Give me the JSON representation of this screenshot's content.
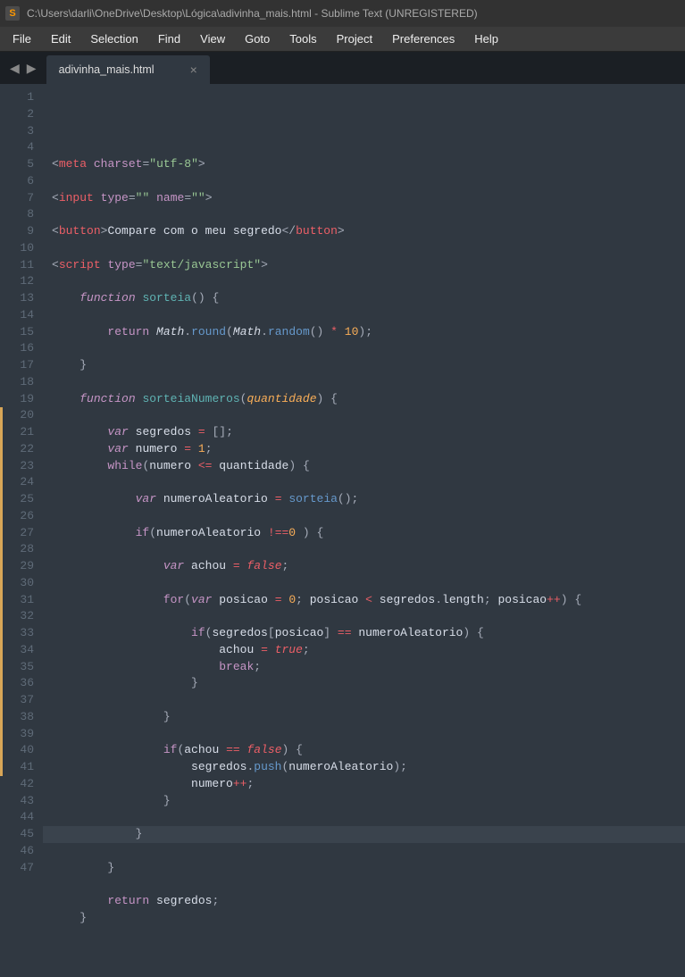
{
  "titlebar": {
    "path": "C:\\Users\\darli\\OneDrive\\Desktop\\Lógica\\adivinha_mais.html - Sublime Text (UNREGISTERED)",
    "icon_letter": "S"
  },
  "menu": {
    "file": "File",
    "edit": "Edit",
    "selection": "Selection",
    "find": "Find",
    "view": "View",
    "goto": "Goto",
    "tools": "Tools",
    "project": "Project",
    "preferences": "Preferences",
    "help": "Help"
  },
  "nav": {
    "back": "◀",
    "forward": "▶"
  },
  "tab": {
    "name": "adivinha_mais.html",
    "close": "×"
  },
  "gutter": {
    "first": 1,
    "last": 47,
    "modified_ranges": [
      [
        20,
        41
      ]
    ],
    "highlighted_line": 45
  },
  "code": {
    "lines": [
      {
        "n": 1,
        "html": "<span class='punct'>&lt;</span><span class='tag'>meta</span> <span class='attr'>charset</span><span class='punct'>=</span><span class='string'>\"utf-8\"</span><span class='punct'>&gt;</span>"
      },
      {
        "n": 2,
        "html": ""
      },
      {
        "n": 3,
        "html": "<span class='punct'>&lt;</span><span class='tag'>input</span> <span class='attr'>type</span><span class='punct'>=</span><span class='string'>\"\"</span> <span class='attr'>name</span><span class='punct'>=</span><span class='string'>\"\"</span><span class='punct'>&gt;</span>"
      },
      {
        "n": 4,
        "html": ""
      },
      {
        "n": 5,
        "html": "<span class='punct'>&lt;</span><span class='tag'>button</span><span class='punct'>&gt;</span><span class='text'>Compare com o meu segredo</span><span class='punct'>&lt;/</span><span class='tag'>button</span><span class='punct'>&gt;</span>"
      },
      {
        "n": 6,
        "html": ""
      },
      {
        "n": 7,
        "html": "<span class='punct'>&lt;</span><span class='tag'>script</span> <span class='attr'>type</span><span class='punct'>=</span><span class='string'>\"text/javascript\"</span><span class='punct'>&gt;</span>"
      },
      {
        "n": 8,
        "html": ""
      },
      {
        "n": 9,
        "html": "    <span class='kw ital'>function</span> <span class='fn'>sorteia</span><span class='punct'>()</span> <span class='punct'>{</span>"
      },
      {
        "n": 10,
        "html": ""
      },
      {
        "n": 11,
        "html": "        <span class='kw'>return</span> <span class='obj'>Math</span><span class='punct'>.</span><span class='fn2'>round</span><span class='punct'>(</span><span class='obj'>Math</span><span class='punct'>.</span><span class='fn2'>random</span><span class='punct'>()</span> <span class='op'>*</span> <span class='num'>10</span><span class='punct'>);</span>"
      },
      {
        "n": 12,
        "html": ""
      },
      {
        "n": 13,
        "html": "    <span class='punct'>}</span>"
      },
      {
        "n": 14,
        "html": ""
      },
      {
        "n": 15,
        "html": "    <span class='kw ital'>function</span> <span class='fn'>sorteiaNumeros</span><span class='punct'>(</span><span class='param'>quantidade</span><span class='punct'>)</span> <span class='punct'>{</span>"
      },
      {
        "n": 16,
        "html": ""
      },
      {
        "n": 17,
        "html": "        <span class='kw2'>var</span> <span class='text'>segredos</span> <span class='op'>=</span> <span class='punct'>[];</span>"
      },
      {
        "n": 18,
        "html": "        <span class='kw2'>var</span> <span class='text'>numero</span> <span class='op'>=</span> <span class='num'>1</span><span class='punct'>;</span>"
      },
      {
        "n": 19,
        "html": "        <span class='kw'>while</span><span class='punct'>(</span><span class='text'>numero</span> <span class='op'>&lt;=</span> <span class='text'>quantidade</span><span class='punct'>)</span> <span class='punct'>{</span>"
      },
      {
        "n": 20,
        "html": ""
      },
      {
        "n": 21,
        "html": "            <span class='kw2'>var</span> <span class='text'>numeroAleatorio</span> <span class='op'>=</span> <span class='fn2'>sorteia</span><span class='punct'>();</span>"
      },
      {
        "n": 22,
        "html": ""
      },
      {
        "n": 23,
        "html": "            <span class='kw'>if</span><span class='punct'>(</span><span class='text'>numeroAleatorio</span> <span class='op'>!==</span><span class='num'>0</span> <span class='punct'>)</span> <span class='punct'>{</span>"
      },
      {
        "n": 24,
        "html": ""
      },
      {
        "n": 25,
        "html": "                <span class='kw2'>var</span> <span class='text'>achou</span> <span class='op'>=</span> <span class='const'>false</span><span class='punct'>;</span>"
      },
      {
        "n": 26,
        "html": ""
      },
      {
        "n": 27,
        "html": "                <span class='kw'>for</span><span class='punct'>(</span><span class='kw2'>var</span> <span class='text'>posicao</span> <span class='op'>=</span> <span class='num'>0</span><span class='punct'>;</span> <span class='text'>posicao</span> <span class='op'>&lt;</span> <span class='text'>segredos</span><span class='punct'>.</span><span class='text'>length</span><span class='punct'>;</span> <span class='text'>posicao</span><span class='op'>++</span><span class='punct'>)</span> <span class='punct'>{</span>"
      },
      {
        "n": 28,
        "html": ""
      },
      {
        "n": 29,
        "html": "                    <span class='kw'>if</span><span class='punct'>(</span><span class='text'>segredos</span><span class='punct'>[</span><span class='text'>posicao</span><span class='punct'>]</span> <span class='op'>==</span> <span class='text'>numeroAleatorio</span><span class='punct'>)</span> <span class='punct'>{</span>"
      },
      {
        "n": 30,
        "html": "                        <span class='text'>achou</span> <span class='op'>=</span> <span class='const'>true</span><span class='punct'>;</span>"
      },
      {
        "n": 31,
        "html": "                        <span class='kw'>break</span><span class='punct'>;</span>"
      },
      {
        "n": 32,
        "html": "                    <span class='punct'>}</span>"
      },
      {
        "n": 33,
        "html": ""
      },
      {
        "n": 34,
        "html": "                <span class='punct'>}</span>"
      },
      {
        "n": 35,
        "html": ""
      },
      {
        "n": 36,
        "html": "                <span class='kw'>if</span><span class='punct'>(</span><span class='text'>achou</span> <span class='op'>==</span> <span class='const'>false</span><span class='punct'>)</span> <span class='punct'>{</span>"
      },
      {
        "n": 37,
        "html": "                    <span class='text'>segredos</span><span class='punct'>.</span><span class='fn2'>push</span><span class='punct'>(</span><span class='text'>numeroAleatorio</span><span class='punct'>);</span>"
      },
      {
        "n": 38,
        "html": "                    <span class='text'>numero</span><span class='op'>++</span><span class='punct'>;</span>"
      },
      {
        "n": 39,
        "html": "                <span class='punct'>}</span>"
      },
      {
        "n": 40,
        "html": ""
      },
      {
        "n": 41,
        "html": "            <span class='punct'>}</span>"
      },
      {
        "n": 42,
        "html": ""
      },
      {
        "n": 43,
        "html": "        <span class='punct'>}</span>"
      },
      {
        "n": 44,
        "html": ""
      },
      {
        "n": 45,
        "html": "        <span class='kw'>return</span> <span class='text'>segredos</span><span class='punct'>;</span>"
      },
      {
        "n": 46,
        "html": "    <span class='punct'>}</span>"
      },
      {
        "n": 47,
        "html": ""
      }
    ]
  }
}
